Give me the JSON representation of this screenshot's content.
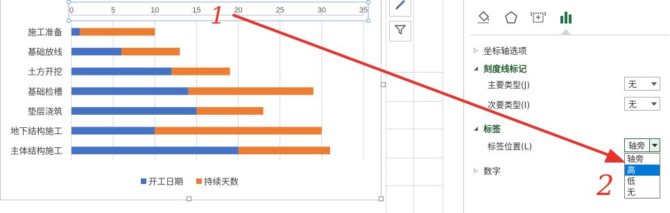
{
  "chart_data": {
    "type": "bar",
    "orientation": "horizontal",
    "stacked": true,
    "categories": [
      "施工准备",
      "基础放线",
      "土方开挖",
      "基础检槽",
      "垫层浇筑",
      "地下结构施工",
      "主体结构施工"
    ],
    "series": [
      {
        "name": "开工日期",
        "color": "#4472c4",
        "values": [
          1,
          6,
          12,
          14,
          15,
          10,
          20
        ]
      },
      {
        "name": "持续天数",
        "color": "#ed7d31",
        "values": [
          9,
          7,
          7,
          15,
          8,
          20,
          11
        ]
      }
    ],
    "xlim": [
      0,
      35
    ],
    "x_ticks": [
      "0",
      "5",
      "10",
      "15",
      "20",
      "25",
      "30",
      "35"
    ],
    "x_axis_position": "top",
    "grid": true,
    "legend": "bottom"
  },
  "chart_buttons": [
    {
      "name": "chart-styles",
      "icon": "brush-icon"
    },
    {
      "name": "chart-filters",
      "icon": "filter-icon"
    }
  ],
  "pane": {
    "tabs": [
      {
        "name": "fill-line",
        "icon": "paint-bucket-icon"
      },
      {
        "name": "effects",
        "icon": "pentagon-icon"
      },
      {
        "name": "size-properties",
        "icon": "size-properties-icon"
      },
      {
        "name": "axis-options",
        "icon": "bar-chart-icon",
        "color": "#217346"
      }
    ],
    "sections": {
      "axis_options": "坐标轴选项",
      "tick_marks": "刻度线标记",
      "labels": "标签",
      "number": "数字"
    },
    "major_type": {
      "label": "主要类型(J)",
      "value": "无"
    },
    "minor_type": {
      "label": "次要类型(I)",
      "value": "无"
    },
    "label_position": {
      "label": "标签位置(L)",
      "value": "轴旁",
      "options": [
        "轴旁",
        "高",
        "低",
        "无"
      ],
      "highlighted": "高"
    }
  },
  "annotations": {
    "mark1": "1",
    "mark2": "2",
    "color": "#e8322b"
  }
}
